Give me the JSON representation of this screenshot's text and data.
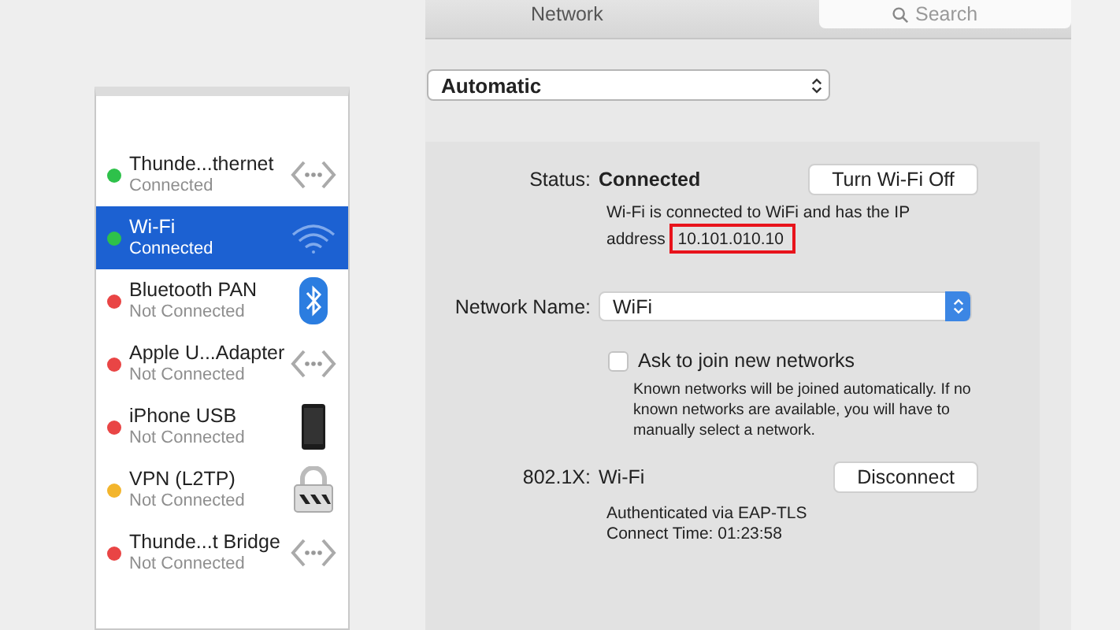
{
  "window": {
    "title": "Network"
  },
  "search": {
    "placeholder": "Search"
  },
  "location": {
    "value": "Automatic"
  },
  "services": [
    {
      "name": "Thunde...thernet",
      "status": "Connected",
      "color": "#2ec14a",
      "kind": "ethernet",
      "selected": false
    },
    {
      "name": "Wi-Fi",
      "status": "Connected",
      "color": "#2ec14a",
      "kind": "wifi",
      "selected": true
    },
    {
      "name": "Bluetooth PAN",
      "status": "Not Connected",
      "color": "#e94545",
      "kind": "bluetooth",
      "selected": false
    },
    {
      "name": "Apple U...Adapter",
      "status": "Not Connected",
      "color": "#e94545",
      "kind": "ethernet",
      "selected": false
    },
    {
      "name": "iPhone USB",
      "status": "Not Connected",
      "color": "#e94545",
      "kind": "phone",
      "selected": false
    },
    {
      "name": "VPN (L2TP)",
      "status": "Not Connected",
      "color": "#f3b52c",
      "kind": "vpn",
      "selected": false
    },
    {
      "name": "Thunde...t Bridge",
      "status": "Not Connected",
      "color": "#e94545",
      "kind": "ethernet",
      "selected": false
    }
  ],
  "detail": {
    "status_label": "Status:",
    "status_value": "Connected",
    "toggle_button": "Turn Wi-Fi Off",
    "status_message": "Wi-Fi is connected to WiFi and has the IP address",
    "ip_address": "10.101.010.10",
    "ip_highlighted": true,
    "network_name_label": "Network Name:",
    "network_name": "WiFi",
    "ask_to_join": {
      "label": "Ask to join new networks",
      "checked": false
    },
    "ask_help": "Known networks will be joined automatically. If no known networks are available, you will have to manually select a network.",
    "dot1x_label": "802.1X:",
    "dot1x_value": "Wi-Fi",
    "disconnect_button": "Disconnect",
    "auth_lines": [
      "Authenticated via EAP-TLS",
      "Connect Time: 01:23:58"
    ]
  }
}
